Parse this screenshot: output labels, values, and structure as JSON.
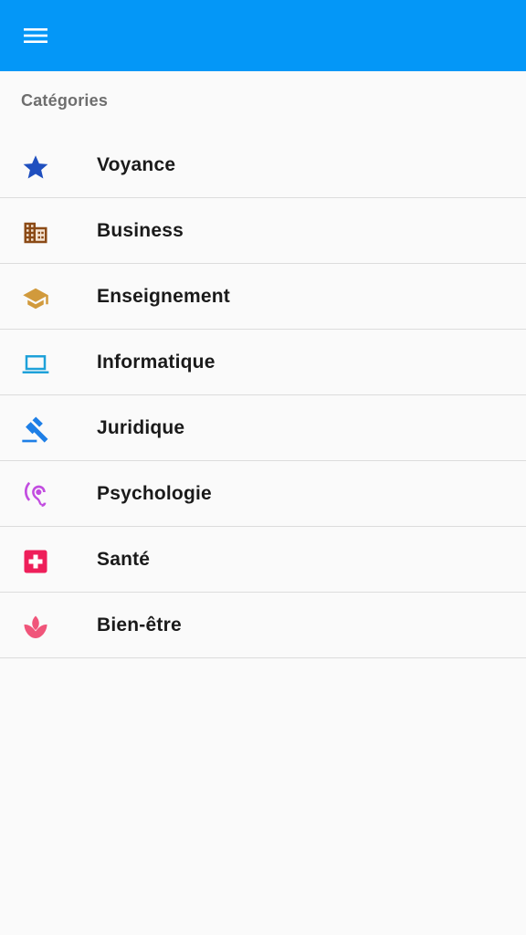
{
  "appbar": {
    "color": "#0497f7",
    "menu_icon": "menu-icon"
  },
  "section": {
    "title": "Catégories"
  },
  "categories": [
    {
      "label": "Voyance",
      "icon": "star-icon",
      "color": "#1f4fbf"
    },
    {
      "label": "Business",
      "icon": "building-icon",
      "color": "#8b4a16"
    },
    {
      "label": "Enseignement",
      "icon": "graduation-cap-icon",
      "color": "#d19a3c"
    },
    {
      "label": "Informatique",
      "icon": "laptop-icon",
      "color": "#1ea1d9"
    },
    {
      "label": "Juridique",
      "icon": "gavel-icon",
      "color": "#1e7fe6"
    },
    {
      "label": "Psychologie",
      "icon": "ear-icon",
      "color": "#c24de0"
    },
    {
      "label": "Santé",
      "icon": "medical-cross-icon",
      "color": "#ee1f5a"
    },
    {
      "label": "Bien-être",
      "icon": "lotus-icon",
      "color": "#f0557a"
    }
  ]
}
